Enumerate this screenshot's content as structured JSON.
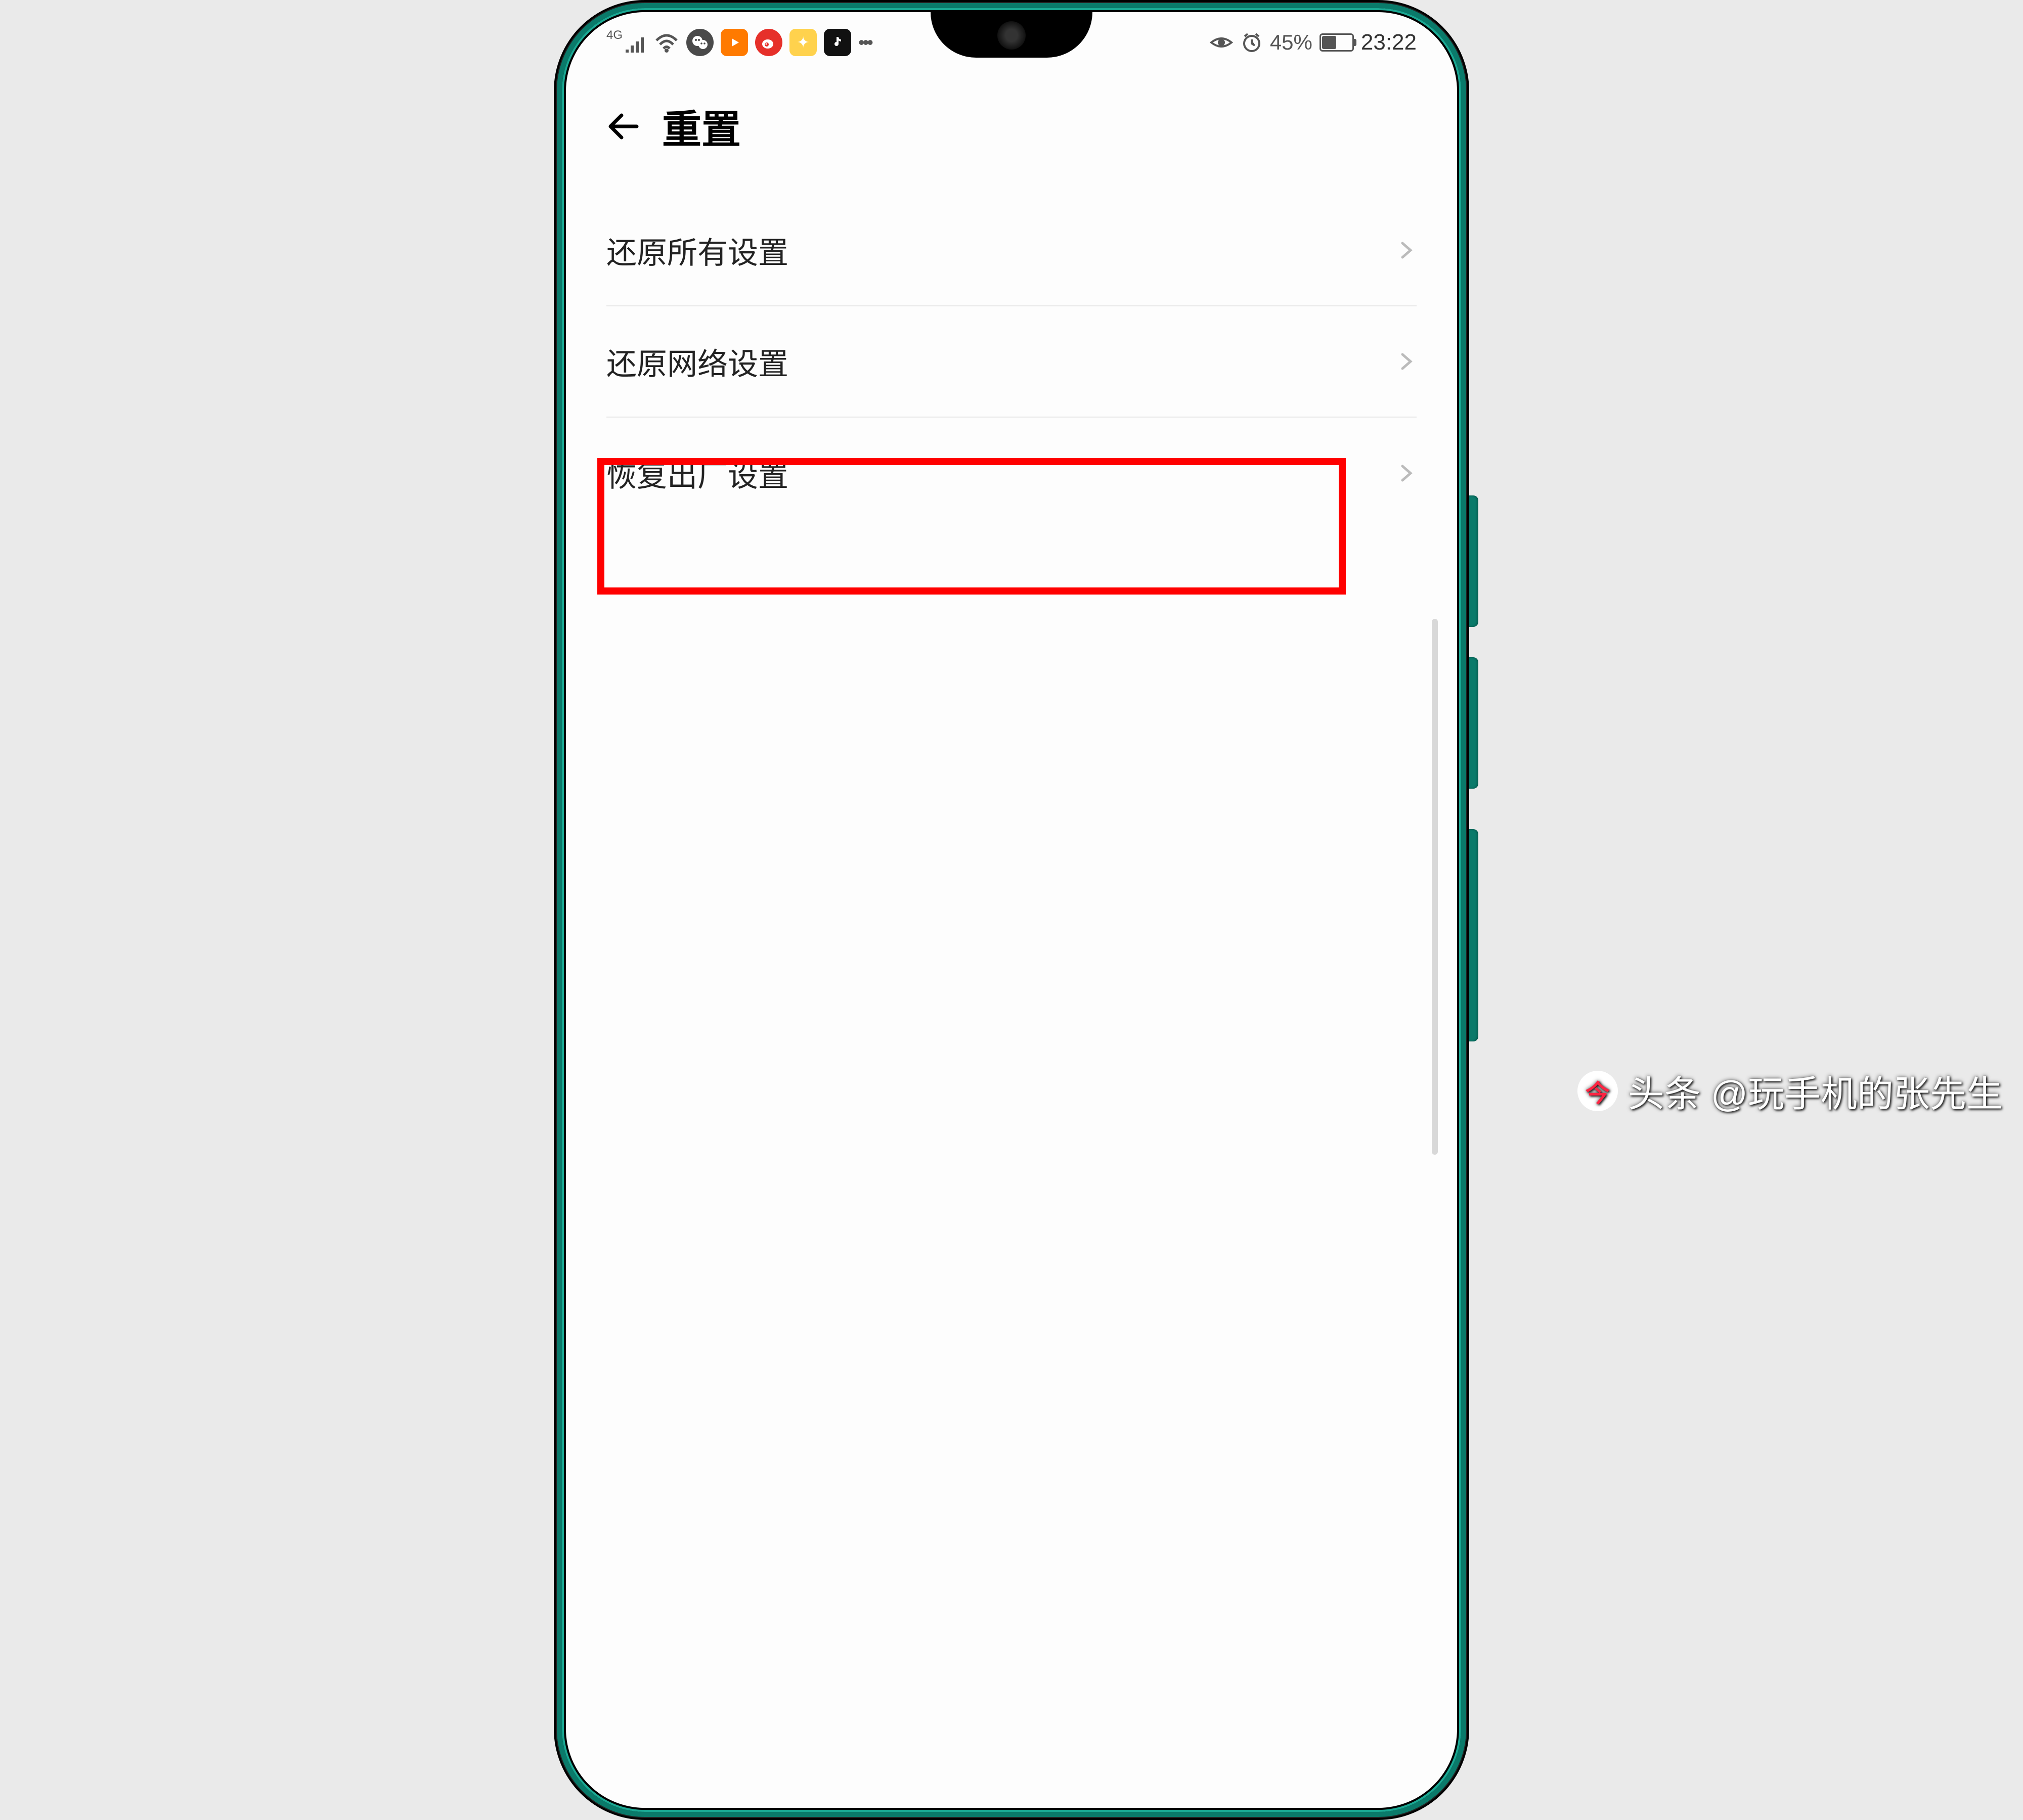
{
  "status_bar": {
    "network_type": "4G",
    "battery_percent": "45%",
    "time": "23:22",
    "icons": {
      "wechat_color": "#4a4a4a",
      "video_color": "#ff7a00",
      "weibo_color": "#e6302a",
      "app4_color": "#ffd24d",
      "tiktok_color": "#111"
    }
  },
  "header": {
    "title": "重置"
  },
  "menu": {
    "items": [
      {
        "label": "还原所有设置"
      },
      {
        "label": "还原网络设置"
      },
      {
        "label": "恢复出厂设置"
      }
    ]
  },
  "watermark": {
    "brand": "头条",
    "handle": "@玩手机的张先生"
  },
  "colors": {
    "highlight": "#ff0000",
    "frame_accent": "#0a7a6a"
  }
}
